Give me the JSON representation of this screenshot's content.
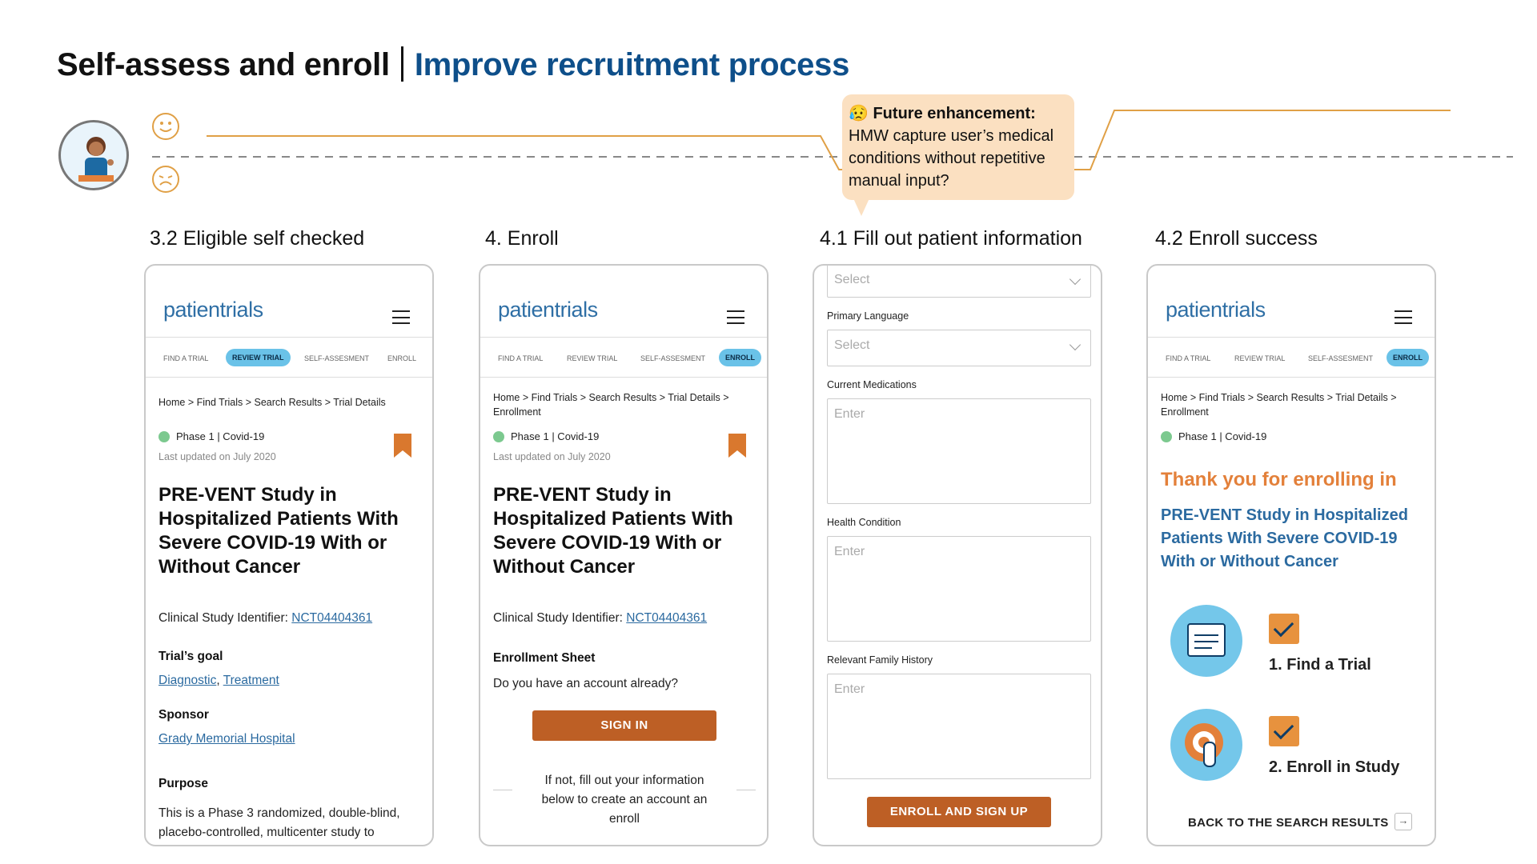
{
  "header": {
    "title_left": "Self-assess and enroll",
    "title_right": "Improve recruitment process"
  },
  "callout": {
    "emoji": "😥",
    "title": "Future enhancement:",
    "body": "HMW capture user’s medical conditions without repetitive manual input?"
  },
  "stages": [
    "3.2 Eligible self checked",
    "4. Enroll",
    "4.1 Fill out patient information",
    "4.2 Enroll success"
  ],
  "app": {
    "logo": "patientrials",
    "nav": [
      "FIND A TRIAL",
      "REVIEW TRIAL",
      "SELF-ASSESMENT",
      "ENROLL"
    ],
    "phase": "Phase 1  |  Covid-19",
    "updated": "Last updated on July 2020",
    "study_title": "PRE-VENT Study in Hospitalized Patients With Severe COVID-19 With or Without Cancer",
    "csi_label": "Clinical Study Identifier:",
    "csi_value": "NCT04404361"
  },
  "screen1": {
    "crumb": "Home > Find Trials > Search Results > Trial Details",
    "goal_label": "Trial’s goal",
    "goal_1": "Diagnostic",
    "goal_sep": ", ",
    "goal_2": "Treatment",
    "sponsor_label": "Sponsor",
    "sponsor_value": "Grady Memorial Hospital",
    "purpose_label": "Purpose",
    "purpose_text": "This is a Phase 3 randomized, double-blind, placebo-controlled, multicenter study to"
  },
  "screen2": {
    "crumb": "Home > Find Trials > Search Results > Trial Details > Enrollment",
    "sheet_label": "Enrollment Sheet",
    "question": "Do you have an account already?",
    "signin": "SIGN IN",
    "ifnot": "If not, fill out your information below to create an account an enroll"
  },
  "screen3": {
    "select_top": "Select",
    "lang_label": "Primary Language",
    "lang_value": "Select",
    "med_label": "Current Medications",
    "med_ph": "Enter",
    "health_label": "Health Condition",
    "health_ph": "Enter",
    "family_label": "Relevant Family History",
    "family_ph": "Enter",
    "button": "ENROLL AND SIGN UP"
  },
  "screen4": {
    "crumb": "Home > Find Trials > Search Results > Trial Details > Enrollment",
    "thanks": "Thank you for enrolling in",
    "study": "PRE-VENT Study in Hospitalized Patients With Severe COVID-19 With or Without Cancer",
    "step1": "1. Find a Trial",
    "step2": "2. Enroll in Study",
    "back": "BACK TO THE SEARCH RESULTS"
  },
  "colors": {
    "accent_orange": "#e0a046",
    "brand_blue": "#2f6fa5",
    "button": "#bd5f25",
    "active_tab": "#6ac2e8"
  }
}
